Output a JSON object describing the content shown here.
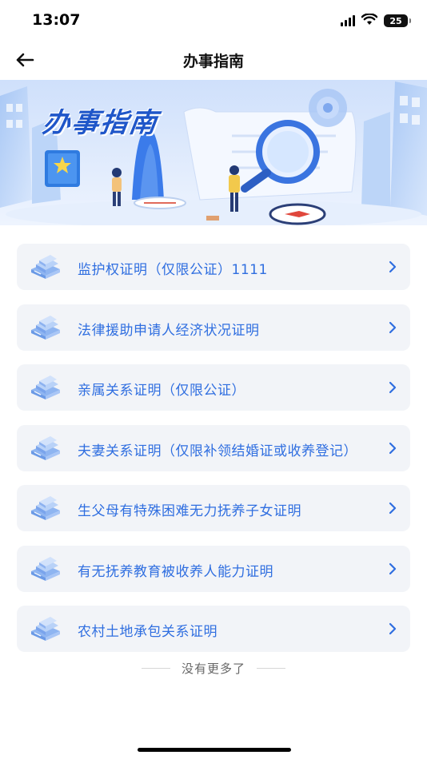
{
  "status_bar": {
    "time": "13:07",
    "battery_level": "25",
    "icons": [
      "signal-icon",
      "wifi-icon",
      "battery-icon"
    ]
  },
  "nav": {
    "title": "办事指南",
    "back_icon": "back-arrow-icon"
  },
  "banner": {
    "title": "办事指南"
  },
  "list": {
    "items": [
      {
        "label": "监护权证明（仅限公证）1111"
      },
      {
        "label": "法律援助申请人经济状况证明"
      },
      {
        "label": "亲属关系证明（仅限公证）"
      },
      {
        "label": "夫妻关系证明（仅限补领结婚证或收养登记）"
      },
      {
        "label": "生父母有特殊困难无力抚养子女证明"
      },
      {
        "label": "有无抚养教育被收养人能力证明"
      },
      {
        "label": "农村土地承包关系证明"
      }
    ],
    "item_icon": "document-stack-icon",
    "chevron_icon": "chevron-right-icon"
  },
  "footer": {
    "no_more": "没有更多了"
  },
  "colors": {
    "accent": "#2f6ee0",
    "item_bg": "#f2f4f8",
    "banner_bg": "#dbe8fb"
  }
}
